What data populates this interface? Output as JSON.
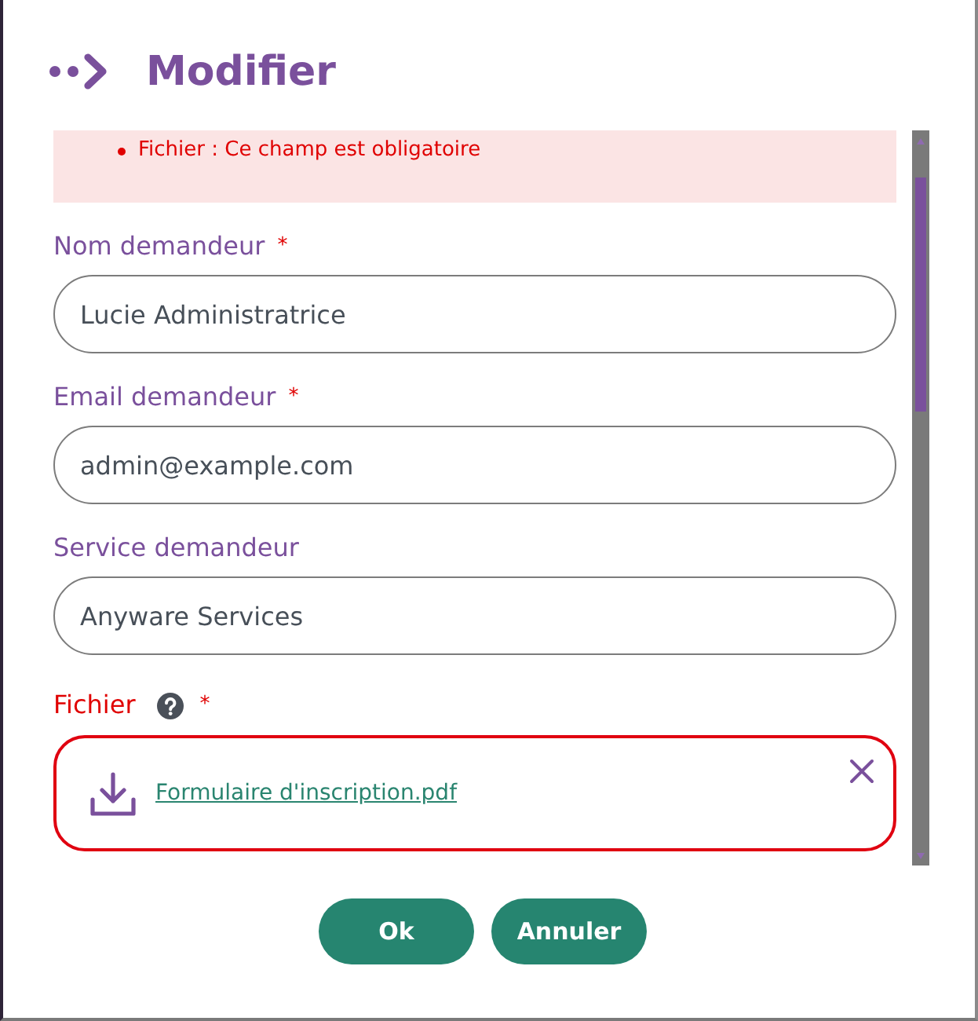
{
  "dialog": {
    "title": "Modifier"
  },
  "errors": [
    {
      "text": "Fichier : Ce champ est obligatoire"
    }
  ],
  "fields": [
    {
      "kind": "text",
      "label": "Nom demandeur",
      "required_mark": "*",
      "invalid": false,
      "help": false,
      "value": "Lucie Administratrice"
    },
    {
      "kind": "text",
      "label": "Email demandeur",
      "required_mark": "*",
      "invalid": false,
      "help": false,
      "value": "admin@example.com"
    },
    {
      "kind": "text",
      "label": "Service demandeur",
      "invalid": false,
      "help": false,
      "value": "Anyware Services"
    },
    {
      "kind": "file",
      "label": "Fichier",
      "required_mark": "*",
      "invalid": true,
      "help": true,
      "file_name": "Formulaire d'inscription.pdf"
    }
  ],
  "buttons": [
    {
      "label": "Ok"
    },
    {
      "label": "Annuler"
    }
  ]
}
